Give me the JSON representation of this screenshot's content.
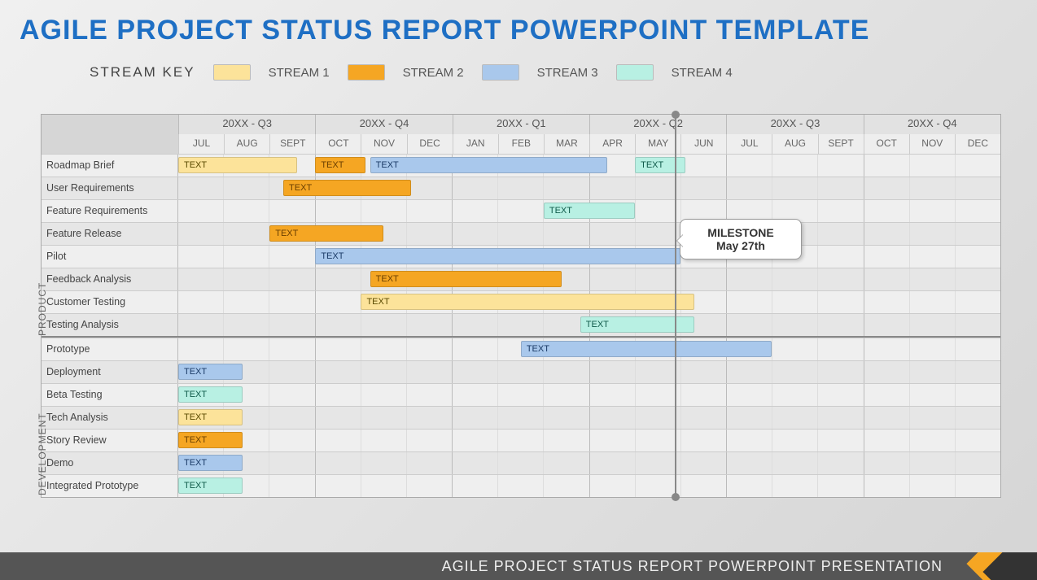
{
  "title": "AGILE PROJECT STATUS REPORT POWERPOINT TEMPLATE",
  "footer": "AGILE PROJECT STATUS REPORT POWERPOINT PRESENTATION",
  "legend": {
    "title": "STREAM KEY",
    "streams": [
      {
        "name": "STREAM 1",
        "color": "#fce39a"
      },
      {
        "name": "STREAM 2",
        "color": "#f5a623"
      },
      {
        "name": "STREAM 3",
        "color": "#a9c8ec"
      },
      {
        "name": "STREAM 4",
        "color": "#b8f0e3"
      }
    ]
  },
  "milestone": {
    "line1": "MILESTONE",
    "line2": "May 27th",
    "month_index": 10.85
  },
  "quarters": [
    "20XX - Q3",
    "20XX - Q4",
    "20XX - Q1",
    "20XX - Q2",
    "20XX - Q3",
    "20XX - Q4"
  ],
  "months": [
    "JUL",
    "AUG",
    "SEPT",
    "OCT",
    "NOV",
    "DEC",
    "JAN",
    "FEB",
    "MAR",
    "APR",
    "MAY",
    "JUN",
    "JUL",
    "AUG",
    "SEPT",
    "OCT",
    "NOV",
    "DEC"
  ],
  "categories": [
    {
      "name": "PRODUCT",
      "tasks": [
        {
          "name": "Roadmap Brief",
          "bars": [
            {
              "stream": 1,
              "start": 0,
              "end": 2.6,
              "label": "TEXT"
            },
            {
              "stream": 2,
              "start": 3,
              "end": 4.1,
              "label": "TEXT"
            },
            {
              "stream": 3,
              "start": 4.2,
              "end": 9.4,
              "label": "TEXT"
            },
            {
              "stream": 4,
              "start": 10,
              "end": 11.1,
              "label": "TEXT"
            }
          ]
        },
        {
          "name": "User Requirements",
          "bars": [
            {
              "stream": 2,
              "start": 2.3,
              "end": 5.1,
              "label": "TEXT"
            }
          ]
        },
        {
          "name": "Feature Requirements",
          "bars": [
            {
              "stream": 4,
              "start": 8,
              "end": 10,
              "label": "TEXT"
            }
          ]
        },
        {
          "name": "Feature Release",
          "bars": [
            {
              "stream": 2,
              "start": 2,
              "end": 4.5,
              "label": "TEXT"
            }
          ]
        },
        {
          "name": "Pilot",
          "bars": [
            {
              "stream": 3,
              "start": 3,
              "end": 11,
              "label": "TEXT"
            }
          ]
        },
        {
          "name": "Feedback Analysis",
          "bars": [
            {
              "stream": 2,
              "start": 4.2,
              "end": 8.4,
              "label": "TEXT"
            }
          ]
        },
        {
          "name": "Customer Testing",
          "bars": [
            {
              "stream": 1,
              "start": 4,
              "end": 11.3,
              "label": "TEXT"
            }
          ]
        },
        {
          "name": "Testing Analysis",
          "bars": [
            {
              "stream": 4,
              "start": 8.8,
              "end": 11.3,
              "label": "TEXT"
            }
          ]
        }
      ]
    },
    {
      "name": "DEVELOPMENT",
      "tasks": [
        {
          "name": "Prototype",
          "bars": [
            {
              "stream": 3,
              "start": 7.5,
              "end": 13,
              "label": "TEXT"
            }
          ]
        },
        {
          "name": "Deployment",
          "bars": [
            {
              "stream": 3,
              "start": 0,
              "end": 1.4,
              "label": "TEXT"
            }
          ]
        },
        {
          "name": "Beta Testing",
          "bars": [
            {
              "stream": 4,
              "start": 0,
              "end": 1.4,
              "label": "TEXT"
            }
          ]
        },
        {
          "name": "Tech Analysis",
          "bars": [
            {
              "stream": 1,
              "start": 0,
              "end": 1.4,
              "label": "TEXT"
            }
          ]
        },
        {
          "name": "Story Review",
          "bars": [
            {
              "stream": 2,
              "start": 0,
              "end": 1.4,
              "label": "TEXT"
            }
          ]
        },
        {
          "name": "Demo",
          "bars": [
            {
              "stream": 3,
              "start": 0,
              "end": 1.4,
              "label": "TEXT"
            }
          ]
        },
        {
          "name": "Integrated Prototype",
          "bars": [
            {
              "stream": 4,
              "start": 0,
              "end": 1.4,
              "label": "TEXT"
            }
          ]
        }
      ]
    }
  ],
  "chart_data": {
    "type": "gantt",
    "unit": "month-index (0 = JUL first year, 18 = end DEC second year)",
    "milestone_at": 10.85,
    "months": [
      "JUL",
      "AUG",
      "SEPT",
      "OCT",
      "NOV",
      "DEC",
      "JAN",
      "FEB",
      "MAR",
      "APR",
      "MAY",
      "JUN",
      "JUL",
      "AUG",
      "SEPT",
      "OCT",
      "NOV",
      "DEC"
    ],
    "streams": {
      "1": "STREAM 1",
      "2": "STREAM 2",
      "3": "STREAM 3",
      "4": "STREAM 4"
    },
    "rows": [
      {
        "group": "PRODUCT",
        "task": "Roadmap Brief",
        "bars": [
          [
            1,
            0,
            2.6
          ],
          [
            2,
            3,
            4.1
          ],
          [
            3,
            4.2,
            9.4
          ],
          [
            4,
            10,
            11.1
          ]
        ]
      },
      {
        "group": "PRODUCT",
        "task": "User Requirements",
        "bars": [
          [
            2,
            2.3,
            5.1
          ]
        ]
      },
      {
        "group": "PRODUCT",
        "task": "Feature Requirements",
        "bars": [
          [
            4,
            8,
            10
          ]
        ]
      },
      {
        "group": "PRODUCT",
        "task": "Feature Release",
        "bars": [
          [
            2,
            2,
            4.5
          ]
        ]
      },
      {
        "group": "PRODUCT",
        "task": "Pilot",
        "bars": [
          [
            3,
            3,
            11
          ]
        ]
      },
      {
        "group": "PRODUCT",
        "task": "Feedback Analysis",
        "bars": [
          [
            2,
            4.2,
            8.4
          ]
        ]
      },
      {
        "group": "PRODUCT",
        "task": "Customer Testing",
        "bars": [
          [
            1,
            4,
            11.3
          ]
        ]
      },
      {
        "group": "PRODUCT",
        "task": "Testing Analysis",
        "bars": [
          [
            4,
            8.8,
            11.3
          ]
        ]
      },
      {
        "group": "DEVELOPMENT",
        "task": "Prototype",
        "bars": [
          [
            3,
            7.5,
            13
          ]
        ]
      },
      {
        "group": "DEVELOPMENT",
        "task": "Deployment",
        "bars": [
          [
            3,
            0,
            1.4
          ]
        ]
      },
      {
        "group": "DEVELOPMENT",
        "task": "Beta Testing",
        "bars": [
          [
            4,
            0,
            1.4
          ]
        ]
      },
      {
        "group": "DEVELOPMENT",
        "task": "Tech Analysis",
        "bars": [
          [
            1,
            0,
            1.4
          ]
        ]
      },
      {
        "group": "DEVELOPMENT",
        "task": "Story Review",
        "bars": [
          [
            2,
            0,
            1.4
          ]
        ]
      },
      {
        "group": "DEVELOPMENT",
        "task": "Demo",
        "bars": [
          [
            3,
            0,
            1.4
          ]
        ]
      },
      {
        "group": "DEVELOPMENT",
        "task": "Integrated Prototype",
        "bars": [
          [
            4,
            0,
            1.4
          ]
        ]
      }
    ]
  }
}
